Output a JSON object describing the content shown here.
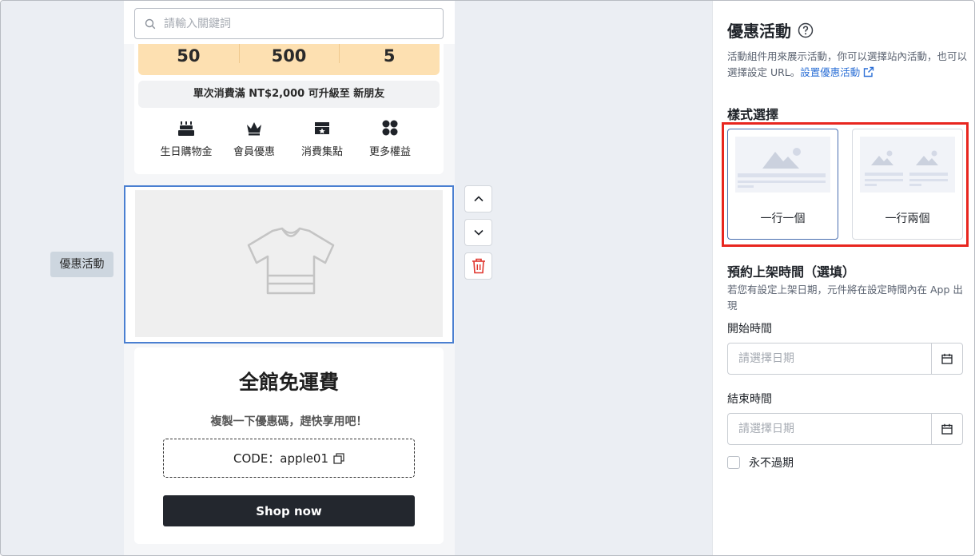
{
  "preview": {
    "search_placeholder": "請輸入關鍵詞",
    "stats": [
      "50",
      "500",
      "5"
    ],
    "upgrade_text": "單次消費滿 NT$2,000 可升級至 新朋友",
    "perks": [
      {
        "label": "生日購物金",
        "icon": "cake-icon"
      },
      {
        "label": "會員優惠",
        "icon": "crown-icon"
      },
      {
        "label": "消費集點",
        "icon": "ticket-icon"
      },
      {
        "label": "更多權益",
        "icon": "grid-icon"
      }
    ],
    "promo_image_icon": "tshirt-placeholder-icon",
    "side_tag": "優惠活動",
    "coupon": {
      "title": "全館免運費",
      "subtitle": "複製一下優惠碼，趕快享用吧！",
      "code": "CODE：apple01",
      "button": "Shop now"
    }
  },
  "controls": [
    "chevron-up-icon",
    "chevron-down-icon",
    "trash-icon"
  ],
  "panel": {
    "title": "優惠活動",
    "description": "活動組件用來展示活動，你可以選擇站內活動，也可以選擇設定 URL。",
    "link": "設置優惠活動",
    "style_section": "樣式選擇",
    "style_options": [
      {
        "label": "一行一個",
        "selected": true
      },
      {
        "label": "一行兩個",
        "selected": false
      }
    ],
    "schedule_section": "預約上架時間（選填）",
    "schedule_desc": "若您有設定上架日期，元件將在設定時間內在 App 出現",
    "start_label": "開始時間",
    "end_label": "結束時間",
    "date_placeholder": "請選擇日期",
    "never_expire": "永不過期"
  },
  "colors": {
    "accent": "#2b6fd6",
    "highlight": "#e8261f",
    "stats_bg": "#fde0b1",
    "button_dark": "#23272e"
  }
}
